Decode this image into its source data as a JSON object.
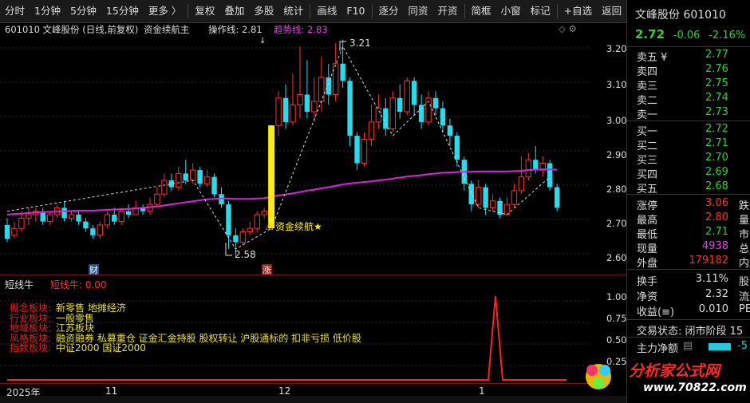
{
  "toolbar": {
    "items": [
      "分时",
      "1分钟",
      "5分钟",
      "15分钟",
      "更多 〉",
      "复权",
      "叠加",
      "多股",
      "统计",
      "画线",
      "F10",
      "逐分",
      "同资",
      "开资",
      "简框",
      "小窗",
      "标记",
      "+自选",
      "返回"
    ]
  },
  "chart_header": {
    "stock": "601010 文峰股份 (日线,前复权)",
    "indicator": "资金续航主",
    "op_label": "操作线: 2.81",
    "trend_label": "趋势线: 2.83"
  },
  "main_chart": {
    "annotation_high": "3.21",
    "annotation_low": "2.58",
    "signal_text": "资金续航★",
    "marker_cai": "财",
    "marker_zhang": "涨",
    "yaxis": [
      "3.20",
      "3.10",
      "3.00",
      "2.90",
      "2.80",
      "2.70",
      "2.60"
    ]
  },
  "sub_chart": {
    "name": "短线牛",
    "value_label": "短线牛: 0.00",
    "yaxis": [
      "1.00",
      "0.75",
      "0.50",
      "0.25"
    ],
    "board_rows": [
      {
        "k": "概念板块:",
        "v": "新零售 地摊经济"
      },
      {
        "k": "行业板块:",
        "v": "一般零售"
      },
      {
        "k": "地域板块:",
        "v": "江苏板块"
      },
      {
        "k": "风格板块:",
        "v": "融资融券 私募重仓 证金汇金持股 股权转让 沪股通标的 扣非亏损 低价股"
      },
      {
        "k": "指数板块:",
        "v": "中证2000 国证2000"
      }
    ]
  },
  "time_axis": {
    "labels": [
      "2025年",
      "11",
      "12",
      "1"
    ]
  },
  "right_panel": {
    "name": "文峰股份",
    "code": "601010",
    "price": "2.72",
    "change": "-0.06",
    "change_pct": "-2.16%",
    "asks": [
      {
        "label": "卖五 ¥",
        "price": "2.77"
      },
      {
        "label": "卖四",
        "price": "2.76"
      },
      {
        "label": "卖三",
        "price": "2.75"
      },
      {
        "label": "卖二",
        "price": "2.74"
      },
      {
        "label": "卖一",
        "price": "2.73"
      }
    ],
    "bids": [
      {
        "label": "买一",
        "price": "2.72"
      },
      {
        "label": "买二",
        "price": "2.71"
      },
      {
        "label": "买三",
        "price": "2.70"
      },
      {
        "label": "买四",
        "price": "2.69"
      },
      {
        "label": "买五",
        "price": "2.68"
      }
    ],
    "stats": [
      {
        "label": "涨停",
        "value": "3.06",
        "label2": "跌停",
        "color": "red"
      },
      {
        "label": "最高",
        "value": "2.80",
        "label2": "量比",
        "color": "red"
      },
      {
        "label": "最低",
        "value": "2.71",
        "label2": "市值",
        "color": "green"
      },
      {
        "label": "现量",
        "value": "4938",
        "label2": "总量",
        "color": "magenta"
      },
      {
        "label": "外盘",
        "value": "179182",
        "label2": "内盘",
        "color": "red"
      }
    ],
    "stats2": [
      {
        "label": "换手",
        "value": "3.11%",
        "label2": "股本"
      },
      {
        "label": "净资",
        "value": "2.32",
        "label2": "流通"
      },
      {
        "label": "收益(≡)",
        "value": "0.010",
        "label2": "PE("
      }
    ],
    "trade_status": "交易状态: 闭市阶段 15",
    "main_flow": "主力净额",
    "main_flow_value": "-5",
    "logo_text": "分析家公式网",
    "logo_url": "www.70822.com"
  }
}
